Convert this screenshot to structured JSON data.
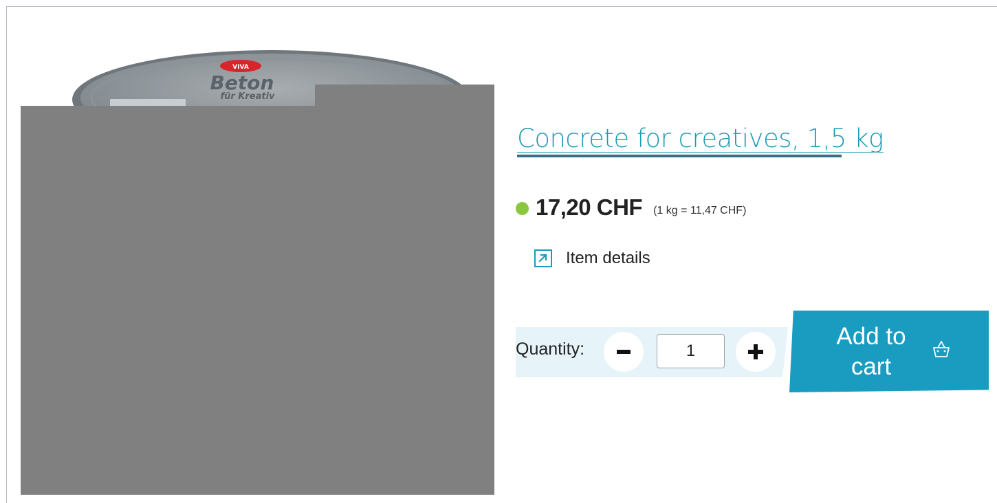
{
  "product": {
    "title": "Concrete for creatives, 1,5 kg",
    "price": "17,20 CHF",
    "unit_price": "(1 kg = 11,47 CHF)",
    "stock_status_color": "#8cc63f",
    "image_alt": "Beton für Kreative",
    "image_lettering": [
      "VIVA",
      "Beton",
      "für Kreativ"
    ]
  },
  "details_link": {
    "label": "Item details",
    "icon": "external-arrow-icon"
  },
  "quantity": {
    "label": "Quantity:",
    "value": "1",
    "decrease_icon": "minus-icon",
    "increase_icon": "plus-icon"
  },
  "cart_button": {
    "label_line1": "Add to",
    "label_line2": "cart",
    "icon": "basket-icon"
  },
  "colors": {
    "accent": "#1d9ab5",
    "cart_button": "#1a9bc0",
    "quantity_bar": "#e6f4f9",
    "image_placeholder": "#808080"
  }
}
